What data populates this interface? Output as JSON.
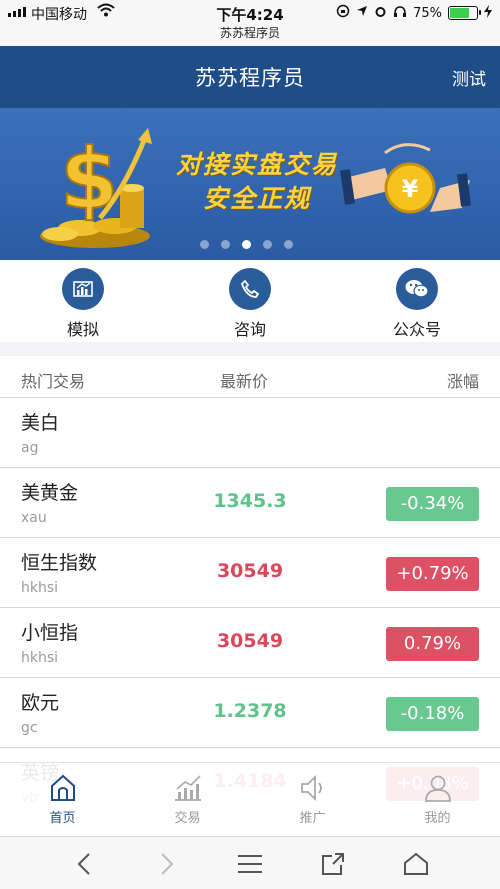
{
  "status_bar": {
    "carrier": "中国移动",
    "time": "下午4:24",
    "battery_text": "75%",
    "battery_level": 0.75,
    "page_subtitle": "苏苏程序员"
  },
  "navbar": {
    "title": "苏苏程序员",
    "right_label": "测试"
  },
  "banner": {
    "line1": "对接实盘交易",
    "line2": "安全正规",
    "slide_count": 5,
    "active_slide": 3
  },
  "quick_links": [
    {
      "label": "模拟",
      "icon": "chart-icon"
    },
    {
      "label": "咨询",
      "icon": "phone-icon"
    },
    {
      "label": "公众号",
      "icon": "wechat-icon"
    }
  ],
  "table": {
    "headers": {
      "name": "热门交易",
      "price": "最新价",
      "change": "涨幅"
    },
    "rows": [
      {
        "name": "美白",
        "code": "ag",
        "price": "",
        "change": ""
      },
      {
        "name": "美黄金",
        "code": "xau",
        "price": "1345.3",
        "change": "-0.34%",
        "trend": "down"
      },
      {
        "name": "恒生指数",
        "code": "hkhsi",
        "price": "30549",
        "change": "+0.79%",
        "trend": "up"
      },
      {
        "name": "小恒指",
        "code": "hkhsi",
        "price": "30549",
        "change": "0.79%",
        "trend": "up"
      },
      {
        "name": "欧元",
        "code": "gc",
        "price": "1.2378",
        "change": "-0.18%",
        "trend": "down"
      },
      {
        "name": "英镑",
        "code": "vb",
        "price": "1.4184",
        "change": "+0.08%",
        "trend": "up"
      }
    ]
  },
  "tabbar": {
    "items": [
      {
        "label": "首页",
        "icon": "home-icon",
        "active": true
      },
      {
        "label": "交易",
        "icon": "trade-icon",
        "active": false
      },
      {
        "label": "推广",
        "icon": "speaker-icon",
        "active": false
      },
      {
        "label": "我的",
        "icon": "user-icon",
        "active": false
      }
    ]
  },
  "colors": {
    "brand": "#1e4d87",
    "up": "#de5064",
    "down": "#68c890"
  }
}
